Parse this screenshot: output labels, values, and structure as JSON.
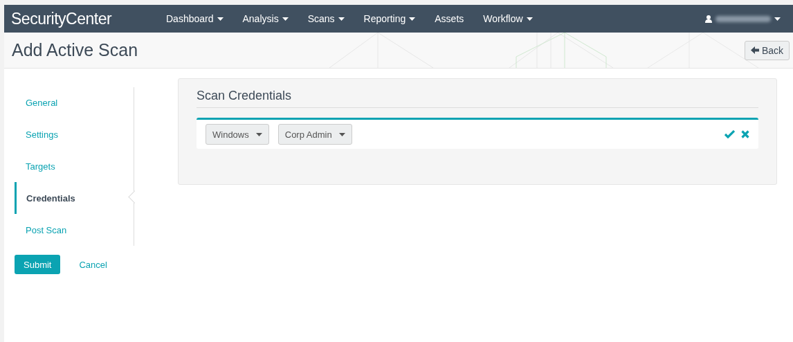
{
  "navbar": {
    "brand": "SecurityCenter",
    "menu": [
      {
        "label": "Dashboard",
        "dropdown": true
      },
      {
        "label": "Analysis",
        "dropdown": true
      },
      {
        "label": "Scans",
        "dropdown": true
      },
      {
        "label": "Reporting",
        "dropdown": true
      },
      {
        "label": "Assets",
        "dropdown": false
      },
      {
        "label": "Workflow",
        "dropdown": true
      }
    ]
  },
  "page_header": {
    "title": "Add Active Scan",
    "back_button": "Back"
  },
  "steps": [
    {
      "label": "General",
      "selected": false
    },
    {
      "label": "Settings",
      "selected": false
    },
    {
      "label": "Targets",
      "selected": false
    },
    {
      "label": "Credentials",
      "selected": true
    },
    {
      "label": "Post Scan",
      "selected": false
    }
  ],
  "actions": {
    "submit": "Submit",
    "cancel": "Cancel"
  },
  "panel": {
    "title": "Scan Credentials",
    "credential": {
      "type": "Windows",
      "name": "Corp Admin"
    }
  }
}
